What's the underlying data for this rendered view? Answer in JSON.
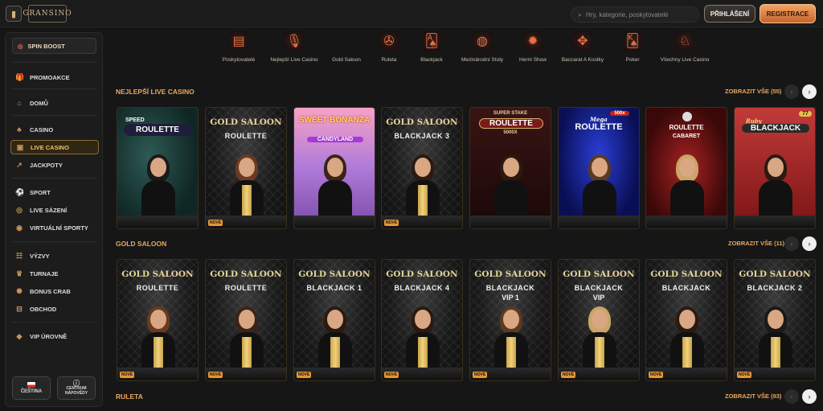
{
  "header": {
    "logo": "GRANSINO",
    "search_placeholder": "Hry, kategorie, poskytovatelé",
    "login": "PŘIHLÁŠENÍ",
    "register": "REGISTRACE"
  },
  "sidebar": {
    "spin": "SPIN BOOST",
    "items": [
      {
        "label": "PROMOAKCE",
        "icon": "gift-icon",
        "glyph": "🎁"
      },
      {
        "label": "DOMŮ",
        "icon": "home-icon",
        "glyph": "⌂"
      },
      {
        "label": "CASINO",
        "icon": "casino-icon",
        "glyph": "♣"
      },
      {
        "label": "LIVE CASINO",
        "icon": "live-casino-icon",
        "glyph": "▣"
      },
      {
        "label": "JACKPOTY",
        "icon": "jackpot-icon",
        "glyph": "↗"
      },
      {
        "label": "SPORT",
        "icon": "sport-icon",
        "glyph": "⚽"
      },
      {
        "label": "LIVE SÁZENÍ",
        "icon": "live-betting-icon",
        "glyph": "◎"
      },
      {
        "label": "VIRTUÁLNÍ SPORTY",
        "icon": "virtual-sports-icon",
        "glyph": "◉"
      },
      {
        "label": "VÝZVY",
        "icon": "challenges-icon",
        "glyph": "☷"
      },
      {
        "label": "TURNAJE",
        "icon": "trophy-icon",
        "glyph": "♛"
      },
      {
        "label": "BONUS CRAB",
        "icon": "crab-icon",
        "glyph": "✺"
      },
      {
        "label": "OBCHOD",
        "icon": "shop-icon",
        "glyph": "⊟"
      },
      {
        "label": "VIP ÚROVNĚ",
        "icon": "vip-icon",
        "glyph": "◆"
      }
    ],
    "lang": "ČEŠTINA",
    "help_line1": "CENTRUM",
    "help_line2": "NÁPOVĚDY"
  },
  "categories": [
    {
      "label": "Poskytovatelé",
      "icon": "providers-icon",
      "glyph": "▤"
    },
    {
      "label": "Nejlepší Live Casino",
      "icon": "microphone-icon",
      "glyph": "🎙"
    },
    {
      "label": "Gold Saloon",
      "icon": "gold-saloon-icon",
      "glyph": ""
    },
    {
      "label": "Ruleta",
      "icon": "roulette-icon",
      "glyph": "✇"
    },
    {
      "label": "Blackjack",
      "icon": "blackjack-icon",
      "glyph": "🂡"
    },
    {
      "label": "Mezinárodní Stoly",
      "icon": "international-tables-icon",
      "glyph": "◍"
    },
    {
      "label": "Herní Show",
      "icon": "game-show-icon",
      "glyph": "✹"
    },
    {
      "label": "Baccarat A Kostky",
      "icon": "baccarat-dice-icon",
      "glyph": "✥"
    },
    {
      "label": "Poker",
      "icon": "poker-icon",
      "glyph": "🂮"
    },
    {
      "label": "Všechny Live Casino",
      "icon": "all-live-casino-icon",
      "glyph": "♘"
    }
  ],
  "sections": [
    {
      "title": "NEJLEPŠÍ LIVE CASINO",
      "view_all": "ZOBRAZIT VŠE (55)"
    },
    {
      "title": "GOLD SALOON",
      "view_all": "ZOBRAZIT VŠE (11)"
    },
    {
      "title": "RULETA",
      "view_all": "ZOBRAZIT VŠE (93)"
    }
  ],
  "row1": [
    {
      "line1": "SPEED",
      "line2": "ROULETTE",
      "new": false
    },
    {
      "line1": "GOLD SALOON",
      "line2": "ROULETTE",
      "new": true
    },
    {
      "line1": "SWEET BONANZA",
      "line2": "CANDYLAND",
      "new": false
    },
    {
      "line1": "GOLD SALOON",
      "line2": "BLACKJACK 3",
      "new": true
    },
    {
      "line1": "SUPER STAKE",
      "line2": "ROULETTE",
      "line3": "5000X",
      "new": false
    },
    {
      "line1": "Mega",
      "line2": "ROULETTE",
      "line3": "500x",
      "new": false
    },
    {
      "line1": "ROULETTE",
      "line2": "CABARET",
      "new": false
    },
    {
      "line1": "Ruby",
      "line2": "BLACKJACK",
      "line3": "77",
      "new": false
    }
  ],
  "row2": [
    {
      "line1": "GOLD SALOON",
      "line2": "ROULETTE",
      "new": true
    },
    {
      "line1": "GOLD SALOON",
      "line2": "ROULETTE",
      "new": true
    },
    {
      "line1": "GOLD SALOON",
      "line2": "BLACKJACK 1",
      "new": true
    },
    {
      "line1": "GOLD SALOON",
      "line2": "BLACKJACK 4",
      "new": true
    },
    {
      "line1": "GOLD SALOON",
      "line2": "BLACKJACK",
      "line3": "VIP 1",
      "new": true
    },
    {
      "line1": "GOLD SALOON",
      "line2": "BLACKJACK",
      "line3": "VIP",
      "new": true
    },
    {
      "line1": "GOLD SALOON",
      "line2": "BLACKJACK",
      "new": true
    },
    {
      "line1": "GOLD SALOON",
      "line2": "BLACKJACK 2",
      "new": true
    }
  ],
  "badge_new": "NOVÉ"
}
